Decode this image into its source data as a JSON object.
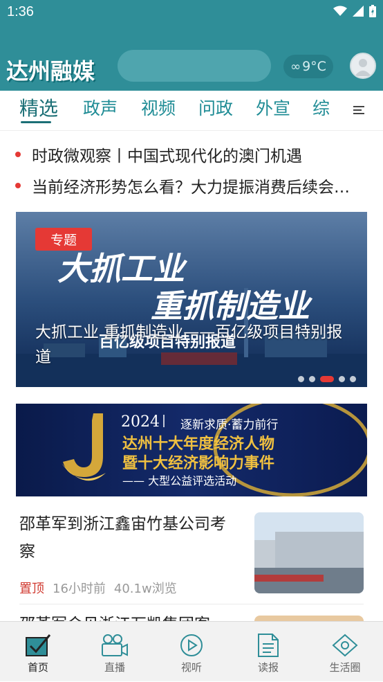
{
  "status_bar": {
    "time": "1:36"
  },
  "header": {
    "logo_text": "达州融媒",
    "weather_text": "9°C",
    "colors": {
      "primary": "#2f8e98",
      "accent": "#e53935"
    }
  },
  "tabs": [
    {
      "label": "精选",
      "active": true
    },
    {
      "label": "政声",
      "active": false
    },
    {
      "label": "视频",
      "active": false
    },
    {
      "label": "问政",
      "active": false
    },
    {
      "label": "外宣",
      "active": false
    },
    {
      "label": "综",
      "active": false
    }
  ],
  "headlines": [
    "时政微观察丨中国式现代化的澳门机遇",
    "当前经济形势怎么看？大力提振消费后续会…"
  ],
  "banner": {
    "tag": "专题",
    "art_line1": "大抓工业",
    "art_line2": "重抓制造业",
    "art_line3": "百亿级项目特别报道",
    "title": "大抓工业 重抓制造业——百亿级项目特别报道"
  },
  "ad": {
    "year": "2024",
    "subtitle": "逐新求质·蓄力前行",
    "line1": "达州十大年度经济人物",
    "line2": "暨十大经济影响力事件",
    "line3": "—— 大型公益评选活动"
  },
  "news": [
    {
      "title": "邵革军到浙江鑫宙竹基公司考察",
      "pin": "置顶",
      "time": "16小时前",
      "views": "40.1w浏览"
    }
  ],
  "next_news_title": "邵革军会见浙江万凯集团客",
  "bottom_nav": [
    {
      "label": "首页",
      "icon": "home-icon",
      "active": true
    },
    {
      "label": "直播",
      "icon": "video-camera-icon",
      "active": false
    },
    {
      "label": "视听",
      "icon": "play-circle-icon",
      "active": false
    },
    {
      "label": "读报",
      "icon": "newspaper-icon",
      "active": false
    },
    {
      "label": "生活圈",
      "icon": "location-pin-icon",
      "active": false
    }
  ]
}
